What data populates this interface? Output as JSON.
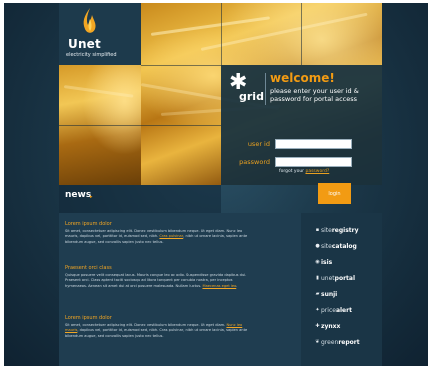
{
  "brand": {
    "name": "Unet",
    "tagline": "electricity simplified"
  },
  "login": {
    "logo_word": "grid",
    "welcome": "welcome!",
    "subtitle": "please enter your user id & password for portal access",
    "user_label": "user id",
    "password_label": "password",
    "forgot_text": "forgot your",
    "forgot_link": "password?",
    "button": "login"
  },
  "news": {
    "heading": "news",
    "articles": [
      {
        "title": "Lorem ipsum dolor",
        "body_before": "Sit amet, consectetuer adipiscing elit. Donec vestibulum bibendum neque. Ut eget diam. Nunc leo mauris, dapibus vel, porttitor id, euismod sed, nibh. ",
        "link": "Cras pulvinar",
        "body_after": ", nibh ut ornare lacinia, sapien ante bibendum augue, sed convallis sapien justo nec tellus."
      },
      {
        "title": "Praesent orci class",
        "body_before": "Quisque posuere velit consequat lacus. Mauris congue leo ac odio. Suspendisse gravida dapibus dui. Praesent orci. Class aptent taciti sociosqu ad litora torquent per conubia nostra, per inceptos hymenaeos. Aenean sit amet dui at orci posuere malesuada. Nullam luctus. ",
        "link": "Maecenas eget leo",
        "body_after": "."
      },
      {
        "title": "Lorem ipsum dolor",
        "body_before": "Sit amet, consectetuer adipiscing elit. Donec vestibulum bibendum neque. Ut eget diam. ",
        "link": "Nunc leo mauris",
        "body_after": ", dapibus vel, porttitor id, euismod sed, nibh. Cras pulvinar, nibh ut ornare lacinia, sapien ante bibendum augue, sed convallis sapien justo nec tellus."
      }
    ]
  },
  "sidebar": {
    "items": [
      {
        "icon": "registry-icon",
        "pre": "site",
        "bold": "registry"
      },
      {
        "icon": "catalog-icon",
        "pre": "site",
        "bold": "catalog"
      },
      {
        "icon": "isis-icon",
        "pre": "",
        "bold": "isis"
      },
      {
        "icon": "portal-icon",
        "pre": "unet",
        "bold": "portal"
      },
      {
        "icon": "sunji-icon",
        "pre": "",
        "bold": "sunji"
      },
      {
        "icon": "alert-icon",
        "pre": "price",
        "bold": "alert"
      },
      {
        "icon": "zynxx-icon",
        "pre": "",
        "bold": "zynxx"
      },
      {
        "icon": "greenreport-icon",
        "pre": "green",
        "bold": "report"
      }
    ]
  }
}
